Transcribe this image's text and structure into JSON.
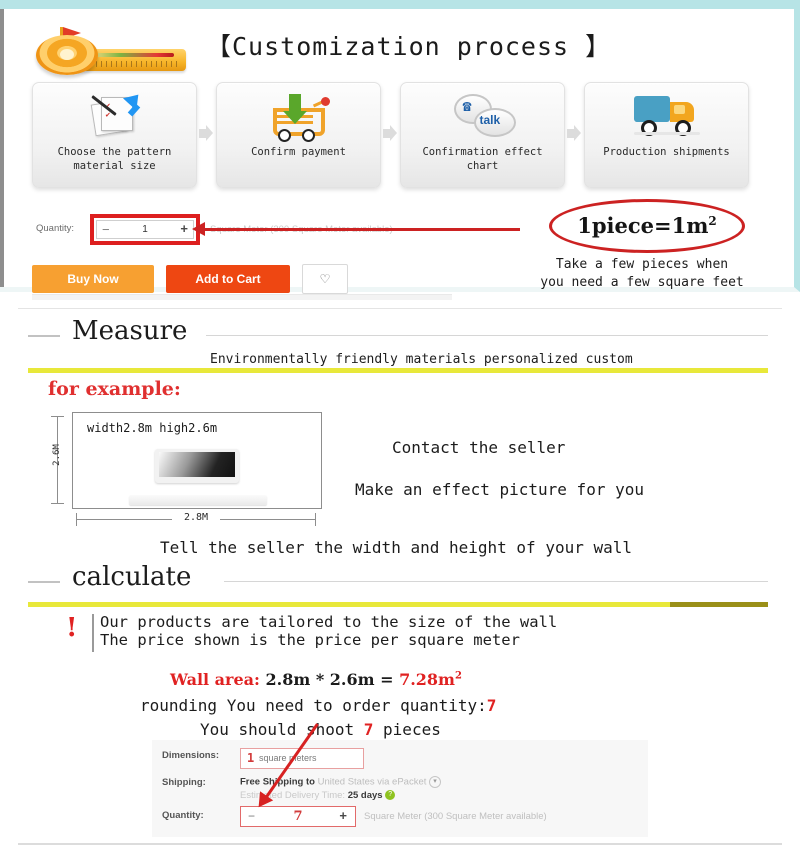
{
  "theme": {
    "accent_teal": "#b7e4e6",
    "accent_red": "#cc2222",
    "accent_yellow": "#e8e83a",
    "buy_now_color": "#f7a031",
    "add_to_cart_color": "#ee4712"
  },
  "top_panel": {
    "title": "【Customization process 】",
    "tape_icon": "measuring-tape-icon",
    "steps": [
      {
        "icon": "document-checklist-icon",
        "label": "Choose the pattern\nmaterial size"
      },
      {
        "icon": "shopping-cart-download-icon",
        "label": "Confirm payment"
      },
      {
        "icon": "chat-bubbles-talk-icon",
        "label": "Confirmation effect\nchart"
      },
      {
        "icon": "delivery-truck-icon",
        "label": "Production shipments"
      }
    ],
    "quantity": {
      "label": "Quantity:",
      "minus": "−",
      "value": "1",
      "plus": "+",
      "availability": "Square Meter (300 Square Meter available)"
    },
    "callout": {
      "ellipse_text": "1piece=1m",
      "ellipse_sup": "2",
      "note": "Take a few pieces when\nyou need a few square feet"
    },
    "actions": {
      "buy_now": "Buy Now",
      "add_to_cart": "Add to Cart",
      "favorite_icon": "heart-icon"
    }
  },
  "measure_section": {
    "heading": "Measure",
    "subtitle": "Environmentally friendly materials personalized custom",
    "for_example": "for example:",
    "diagram": {
      "top_label": "width2.8m   high2.6m",
      "height_label": "2.6M",
      "width_label": "2.8M",
      "tv_icon": "television-icon"
    },
    "right_lines": [
      "Contact the seller",
      "Make an effect picture for you"
    ],
    "bottom_line": "Tell the seller the width and height of your wall"
  },
  "calculate_section": {
    "heading": "calculate",
    "warning_icon": "exclamation-icon",
    "notes": [
      "Our products are tailored to the size of the wall",
      "The price shown is the price per square meter"
    ],
    "wall_area": {
      "label": "Wall area:",
      "expression": " 2.8m * 2.6m = ",
      "result": "7.28m",
      "result_sup": "2"
    },
    "rounding_line": {
      "prefix": "rounding  You need to order quantity:",
      "value": "7"
    },
    "shoot_line": {
      "prefix": "You should shoot ",
      "value": "7",
      "suffix": " pieces"
    },
    "form": {
      "dimensions_label": "Dimensions:",
      "dimensions_value": "1",
      "dimensions_unit": "square meters",
      "shipping_label": "Shipping:",
      "shipping_free": "Free Shipping to ",
      "shipping_dest": "United States via ePacket",
      "shipping_dropdown_icon": "chevron-down-icon",
      "delivery_prefix": "Estimated Delivery Time: ",
      "delivery_days": "25 days",
      "delivery_help_icon": "question-mark-icon",
      "quantity_label": "Quantity:",
      "qty_minus": "−",
      "qty_value": "7",
      "qty_plus": "+",
      "qty_availability": "Square Meter (300 Square Meter available)"
    }
  }
}
